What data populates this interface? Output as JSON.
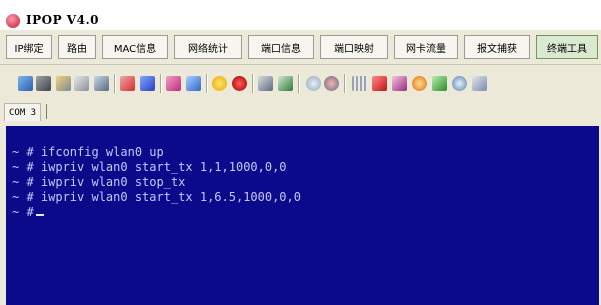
{
  "window": {
    "title": "IPOP V4.0"
  },
  "tabs": [
    {
      "label": "IP绑定",
      "active": false
    },
    {
      "label": "路由",
      "active": false
    },
    {
      "label": "MAC信息",
      "active": false
    },
    {
      "label": "网络统计",
      "active": false
    },
    {
      "label": "端口信息",
      "active": false
    },
    {
      "label": "端口映射",
      "active": false
    },
    {
      "label": "网卡流量",
      "active": false
    },
    {
      "label": "报文捕获",
      "active": false
    },
    {
      "label": "终端工具",
      "active": true
    }
  ],
  "toolbar": {
    "icons": [
      "connect-icon",
      "disconnect-icon",
      "edit-icon",
      "copy-icon",
      "undo-icon",
      "user-icon",
      "paint-icon",
      "keyboard-icon",
      "search-users-icon",
      "sun-icon",
      "record-icon",
      "window-icon",
      "settings-icon",
      "zoom-icon",
      "target-icon",
      "grid-icon",
      "red-box-icon",
      "eraser-icon",
      "face-icon",
      "tool-icon",
      "zoom-in-icon",
      "brush-icon"
    ]
  },
  "com_tab": {
    "label": "COM 3"
  },
  "terminal": {
    "lines": [
      "~ # ifconfig wlan0 up",
      "~ # iwpriv wlan0 start_tx 1,1,1000,0,0",
      "~ # iwpriv wlan0 stop_tx",
      "~ # iwpriv wlan0 start_tx 1,6.5,1000,0,0",
      "~ #"
    ]
  },
  "colors": {
    "terminal_bg": "#0a0a8a",
    "terminal_text": "#c7c7ff",
    "active_tab": "#d9ead0"
  }
}
